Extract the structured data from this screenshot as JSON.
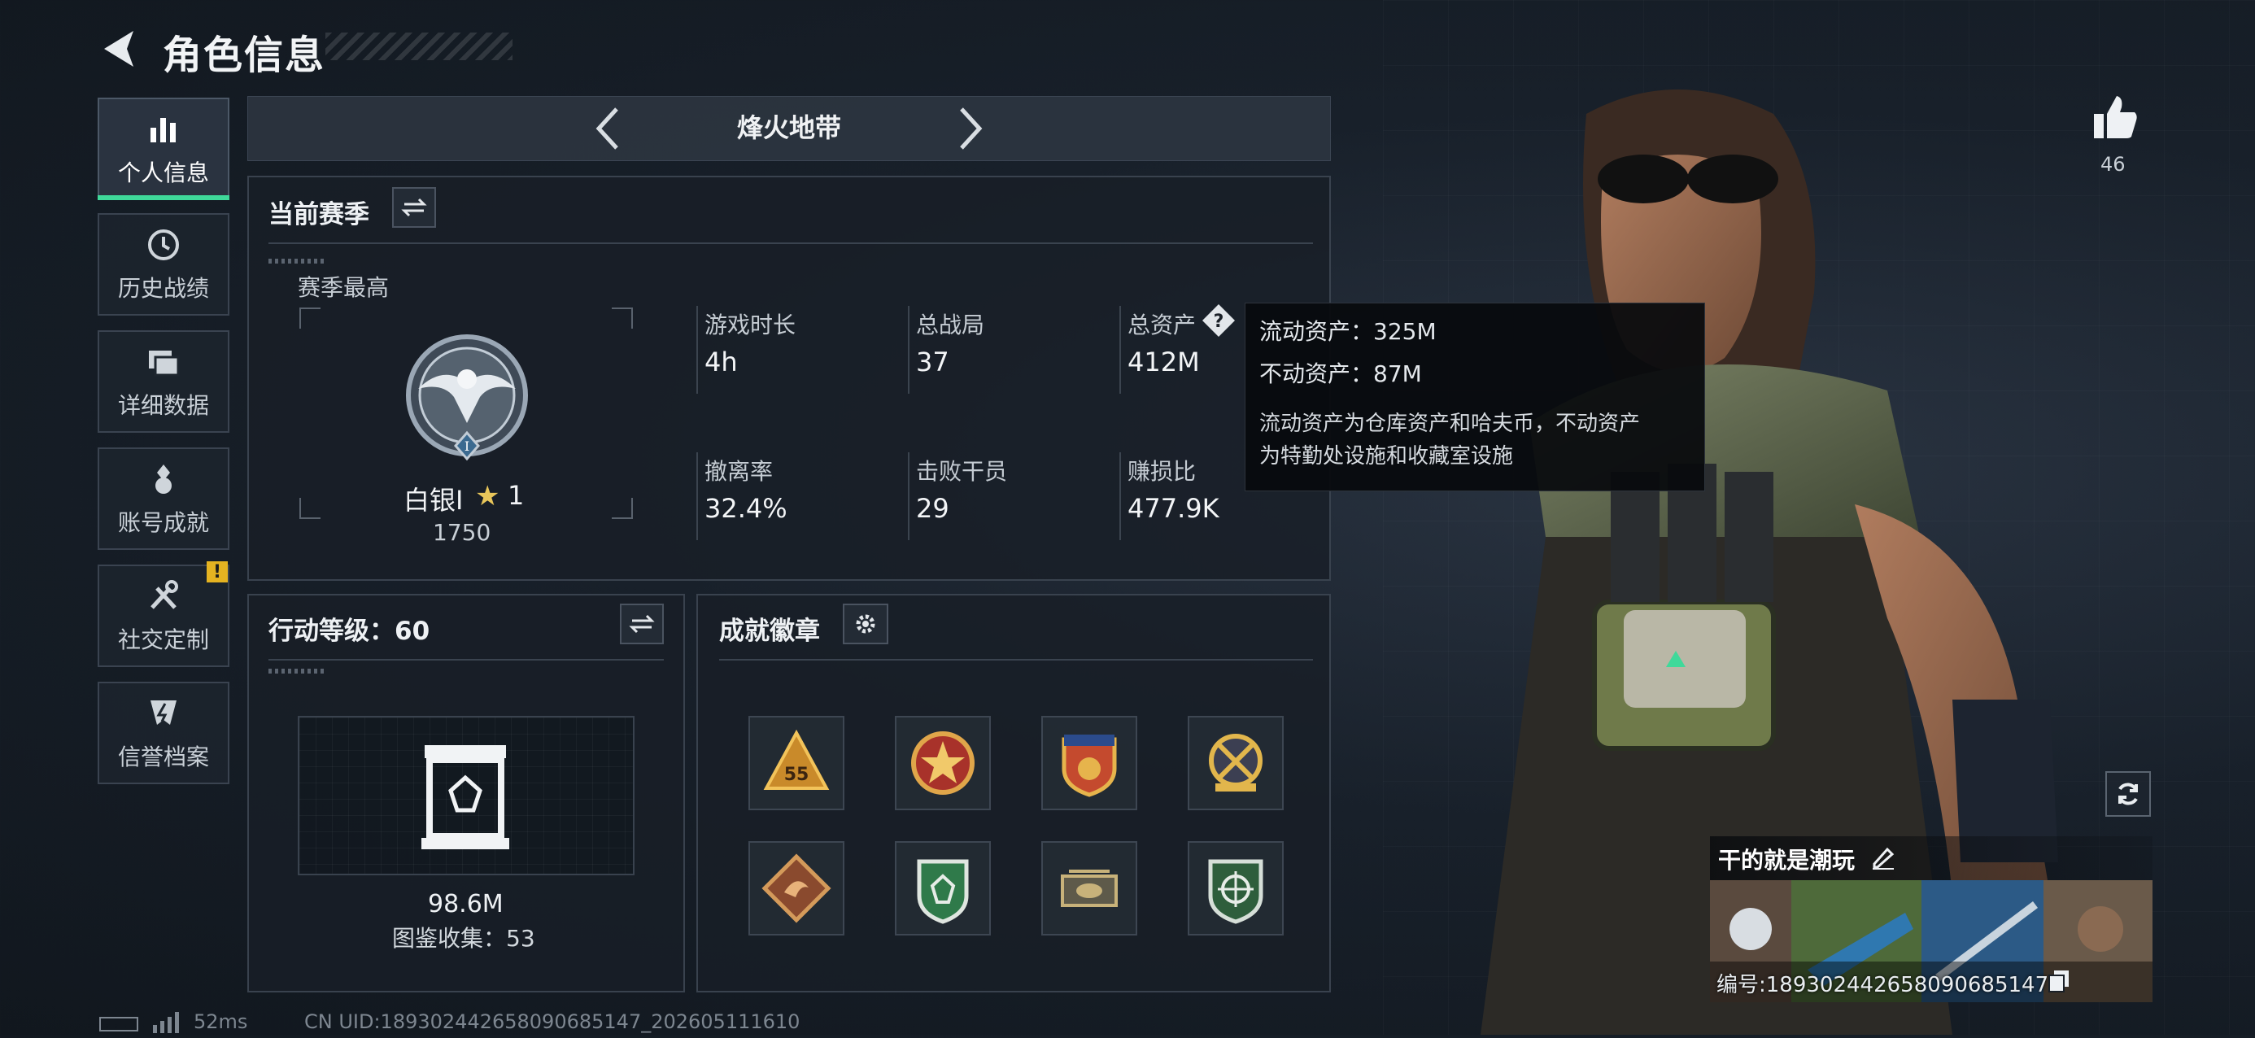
{
  "header": {
    "title": "角色信息"
  },
  "sidebar": {
    "items": [
      {
        "label": "个人信息",
        "icon": "bar-chart-icon",
        "active": true
      },
      {
        "label": "历史战绩",
        "icon": "history-clock-icon"
      },
      {
        "label": "详细数据",
        "icon": "folders-icon"
      },
      {
        "label": "账号成就",
        "icon": "medal-icon"
      },
      {
        "label": "社交定制",
        "icon": "wrench-tools-icon",
        "badge": "!"
      },
      {
        "label": "信誉档案",
        "icon": "shield-bolt-icon"
      }
    ]
  },
  "mode": {
    "title": "烽火地带"
  },
  "season": {
    "title": "当前赛季",
    "best_label": "赛季最高",
    "rank_name": "白银I",
    "rank_stars": "1",
    "rank_points": "1750",
    "stats": [
      {
        "label": "游戏时长",
        "value": "4h"
      },
      {
        "label": "总战局",
        "value": "37"
      },
      {
        "label": "总资产",
        "value": "412M"
      },
      {
        "label": "撤离率",
        "value": "32.4%"
      },
      {
        "label": "击败干员",
        "value": "29"
      },
      {
        "label": "赚损比",
        "value": "477.9K"
      }
    ]
  },
  "tooltip": {
    "liquid": "流动资产：325M",
    "fixed": "不动资产：87M",
    "desc1": "流动资产为仓库资产和哈夫币，不动资产",
    "desc2": "为特勤处设施和收藏室设施"
  },
  "level": {
    "title": "行动等级：60",
    "value": "98.6M",
    "collection": "图鉴收集：53"
  },
  "badges": {
    "title": "成就徽章",
    "items": [
      {
        "icon": "triangle-55-badge-icon"
      },
      {
        "icon": "star-circle-badge-icon"
      },
      {
        "icon": "shield-stars-badge-icon"
      },
      {
        "icon": "crossed-arrows-badge-icon"
      },
      {
        "icon": "dragon-diamond-badge-icon"
      },
      {
        "icon": "green-shield-badge-icon"
      },
      {
        "icon": "helicopter-badge-icon"
      },
      {
        "icon": "crosshair-badge-icon"
      }
    ]
  },
  "character": {
    "likes": "46",
    "card_name": "干的就是潮玩",
    "card_id": "编号:18930244265809068514​7"
  },
  "footer": {
    "ping": "52ms",
    "uid": "CN UID:18930244265809068514​7_202605111610"
  },
  "colors": {
    "accent": "#3fd99a",
    "warning": "#e5b321",
    "panel_border": "#39424e"
  }
}
